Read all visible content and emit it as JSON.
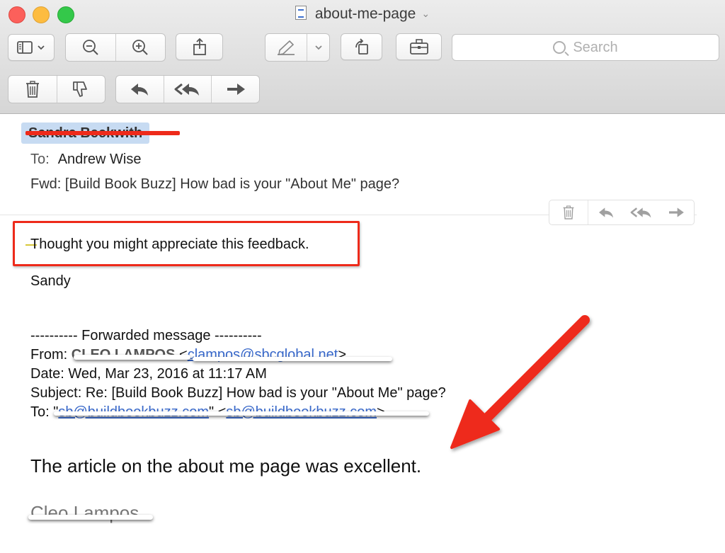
{
  "window": {
    "title": "about-me-page",
    "search_placeholder": "Search"
  },
  "message": {
    "sender": "Sandra Beckwith",
    "to_label": "To:",
    "to_value": "Andrew Wise",
    "subject": "Fwd: [Build Book Buzz] How bad is your \"About Me\" page?",
    "body_line1": "Thought you might appreciate this feedback.",
    "body_line2": "Sandy",
    "forwarded_header": "---------- Forwarded message ----------",
    "from_label": "From:",
    "from_name": "CLEO LAMPOS",
    "from_email": "clampos@sbcglobal.net",
    "date_line": "Date: Wed, Mar 23, 2016 at 11:17 AM",
    "subject_line": "Subject: Re: [Build Book Buzz] How bad is your \"About Me\" page?",
    "to_line_label": "To: ",
    "to_line_email1": "sb@buildbookbuzz.com",
    "to_line_email2": "sb@buildbookbuzz.com",
    "article_line": "The article on the about me page was excellent.",
    "signature": "Cleo Lampos"
  },
  "colors": {
    "annotation_red": "#ee2a1a",
    "link_blue": "#3767c9"
  },
  "icons": {
    "toolbar_row1": [
      "sidebar-icon",
      "chevron-down-icon",
      "zoom-out-icon",
      "zoom-in-icon",
      "share-icon",
      "markup-pen-icon",
      "chevron-down-icon",
      "rotate-icon",
      "toolbox-icon",
      "search-icon"
    ],
    "toolbar_row2": [
      "trash-icon",
      "junk-thumbs-down-icon",
      "reply-icon",
      "reply-all-icon",
      "forward-icon"
    ]
  }
}
